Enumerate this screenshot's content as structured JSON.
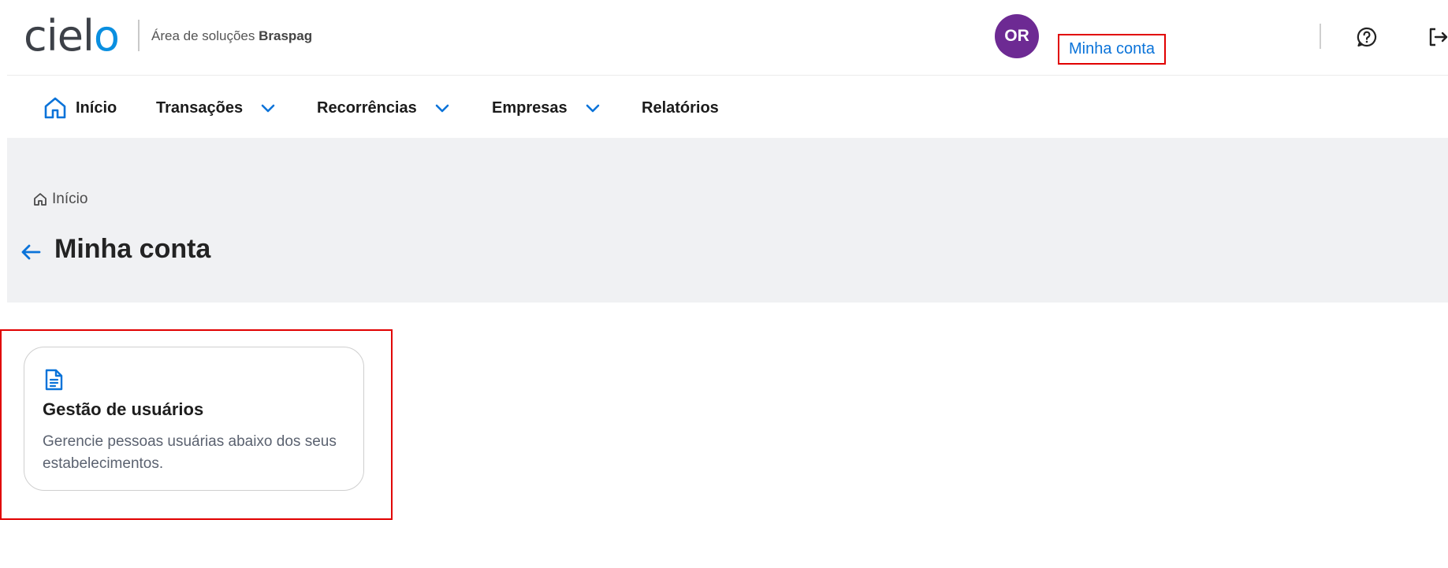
{
  "header": {
    "logo_text": "ciel",
    "logo_text_last": "o",
    "area_prefix": "Área de soluções",
    "area_brand": "Braspag",
    "avatar_initials": "OR",
    "user_name": "",
    "account_link": "Minha conta"
  },
  "nav": {
    "home": "Início",
    "transactions": "Transações",
    "recurrences": "Recorrências",
    "companies": "Empresas",
    "reports": "Relatórios"
  },
  "breadcrumb": {
    "home": "Início"
  },
  "page": {
    "title": "Minha conta"
  },
  "cards": [
    {
      "title": "Gestão de usuários",
      "description": "Gerencie pessoas usuárias abaixo dos seus estabelecimentos."
    }
  ],
  "colors": {
    "accent_blue": "#0a73d9",
    "avatar_purple": "#6d2a93",
    "highlight_red": "#e10000",
    "band_gray": "#f0f1f3"
  }
}
